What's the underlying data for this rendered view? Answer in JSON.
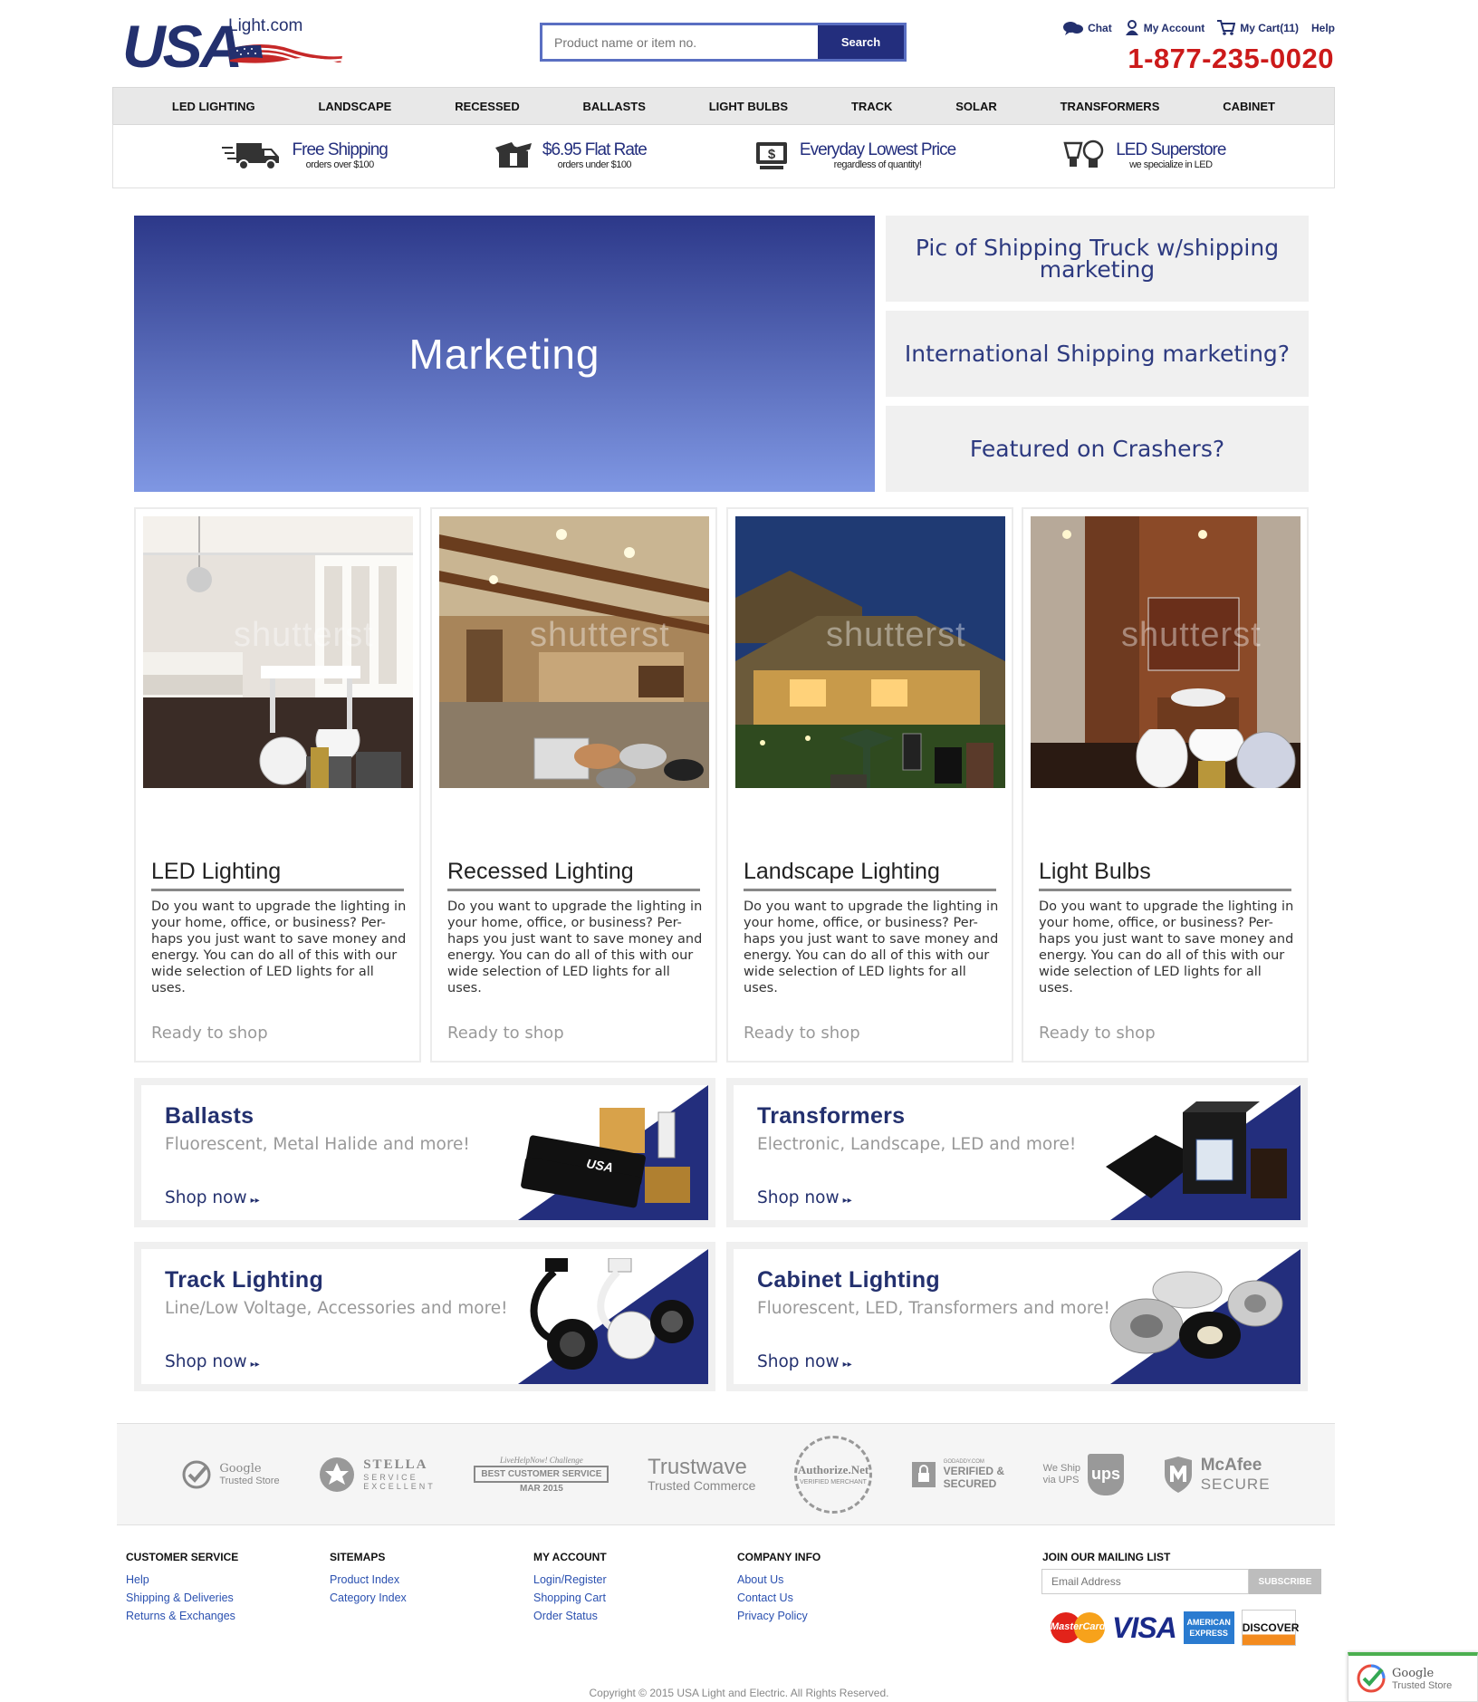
{
  "header": {
    "logo_main": "USA",
    "logo_domain": "Light.com",
    "search_placeholder": "Product name or item no.",
    "search_button": "Search",
    "links": {
      "chat": "Chat",
      "account": "My Account",
      "cart": "My Cart(11)",
      "help": "Help"
    },
    "phone": "1-877-235-0020"
  },
  "nav": [
    "LED LIGHTING",
    "LANDSCAPE",
    "RECESSED",
    "BALLASTS",
    "LIGHT BULBS",
    "TRACK",
    "SOLAR",
    "TRANSFORMERS",
    "CABINET"
  ],
  "benefits": [
    {
      "title": "Free Shipping",
      "sub": "orders over $100",
      "icon": "truck-icon"
    },
    {
      "title": "$6.95 Flat Rate",
      "sub": "orders under $100",
      "icon": "box-icon"
    },
    {
      "title": "Everyday Lowest Price",
      "sub": "regardless of quantity!",
      "icon": "dollar-icon"
    },
    {
      "title": "LED Superstore",
      "sub": "we specialize in LED",
      "icon": "bulbs-icon"
    }
  ],
  "hero": {
    "text": "Marketing"
  },
  "promos": [
    "Pic of Shipping Truck w/shipping marketing",
    "International Shipping marketing?",
    "Featured on Crashers?"
  ],
  "cards": [
    {
      "title": "LED Lighting",
      "watermark": "shutterst",
      "desc": "Do you want to upgrade the  lighting in your home, office, or business?  Per-haps you just want to save money and energy.  You can do all of this with our wide selection of LED lights for all uses.",
      "cta": "Ready to shop"
    },
    {
      "title": "Recessed Lighting",
      "watermark": "shutterst",
      "desc": "Do you want to upgrade the  lighting in your home, office, or business?  Per-haps you just want to save money and energy.  You can do all of this with our wide selection of LED lights for all uses.",
      "cta": "Ready to shop"
    },
    {
      "title": "Landscape Lighting",
      "watermark": "shutterst",
      "desc": "Do you want to upgrade the  lighting in your home, office, or business?  Per-haps you just want to save money and energy.  You can do all of this with our wide selection of LED lights for all uses.",
      "cta": "Ready to shop"
    },
    {
      "title": "Light Bulbs",
      "watermark": "shutterst",
      "desc": "Do you want to upgrade the  lighting in your home, office, or business?  Per-haps you just want to save money and energy.  You can do all of this with our wide selection of LED lights for all uses.",
      "cta": "Ready to shop"
    }
  ],
  "categories": [
    {
      "title": "Ballasts",
      "sub": "Fluorescent, Metal Halide and more!",
      "shop": "Shop now"
    },
    {
      "title": "Transformers",
      "sub": "Electronic, Landscape, LED and more!",
      "shop": "Shop now"
    },
    {
      "title": "Track Lighting",
      "sub": "Line/Low Voltage, Accessories and more!",
      "shop": "Shop now"
    },
    {
      "title": "Cabinet Lighting",
      "sub": "Fluorescent, LED, Transformers and more!",
      "shop": "Shop now"
    }
  ],
  "trust": {
    "google": [
      "Google",
      "Trusted Store"
    ],
    "stella": [
      "STELLA",
      "SERVICE",
      "EXCELLENT"
    ],
    "livehelp": [
      "LiveHelpNow! Challenge",
      "BEST CUSTOMER SERVICE",
      "MAR 2015"
    ],
    "trustwave": [
      "Trustwave",
      "Trusted Commerce"
    ],
    "authorize": [
      "Authorize.Net",
      "VERIFIED MERCHANT"
    ],
    "godaddy": [
      "GODADDY.COM",
      "VERIFIED &",
      "SECURED"
    ],
    "ups": [
      "We Ship",
      "via UPS",
      "ups"
    ],
    "mcafee": [
      "McAfee",
      "SECURE"
    ]
  },
  "footer": {
    "customer_service": {
      "title": "CUSTOMER SERVICE",
      "links": [
        "Help",
        "Shipping & Deliveries",
        "Returns & Exchanges"
      ]
    },
    "sitemaps": {
      "title": "SITEMAPS",
      "links": [
        "Product Index",
        "Category Index"
      ]
    },
    "my_account": {
      "title": "MY ACCOUNT",
      "links": [
        "Login/Register",
        "Shopping Cart",
        "Order Status"
      ]
    },
    "company": {
      "title": "COMPANY INFO",
      "links": [
        "About Us",
        "Contact Us",
        "Privacy Policy"
      ]
    },
    "mailing": {
      "title": "JOIN OUR MAILING LIST",
      "placeholder": "Email Address",
      "button": "SUBSCRIBE"
    },
    "payments": [
      "MasterCard",
      "VISA",
      "AMERICAN EXPRESS",
      "DISCOVER"
    ],
    "copyright": "Copyright © 2015 USA Light and Electric. All Rights Reserved."
  },
  "google_widget": [
    "Google",
    "Trusted Store"
  ],
  "colors": {
    "brand_navy": "#232e7d",
    "phone_red": "#cc1a1a",
    "link_blue": "#2a50b0"
  }
}
